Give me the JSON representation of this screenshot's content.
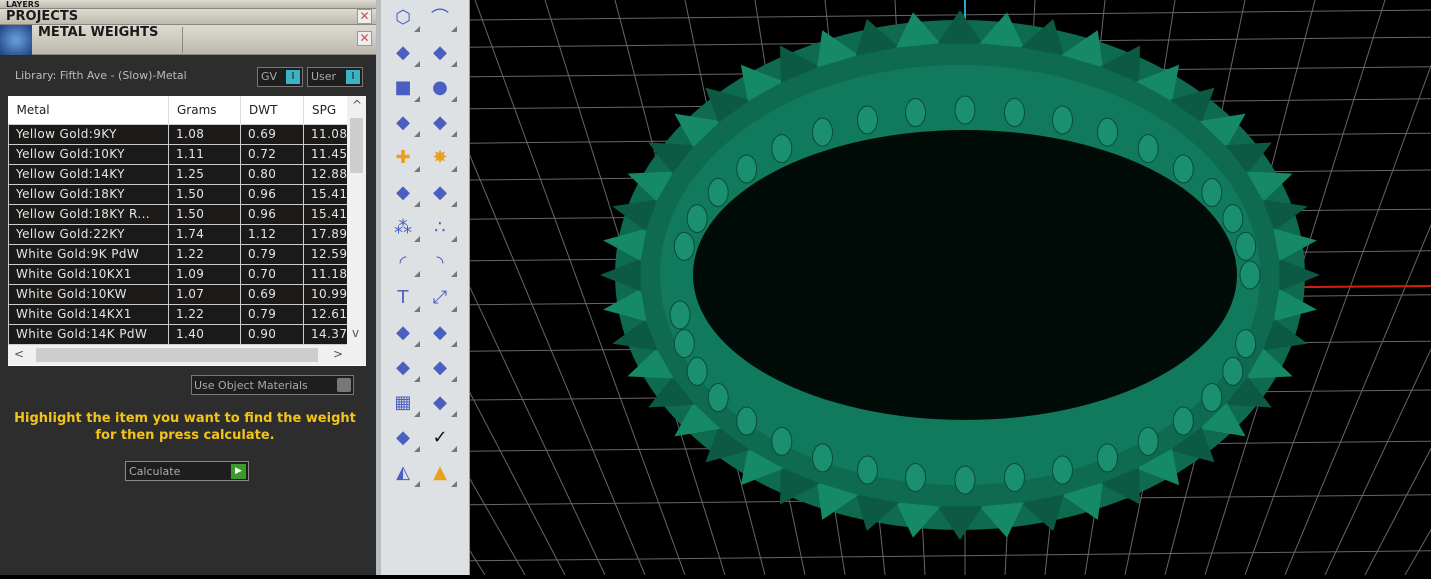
{
  "panels": {
    "layers": "LAYERS",
    "projects": "PROJECTS",
    "metal_weights": "METAL WEIGHTS"
  },
  "library": "Library: Fifth Ave - (Slow)-Metal",
  "toggles": {
    "gv": "GV",
    "user": "User"
  },
  "table": {
    "headers": [
      "Metal",
      "Grams",
      "DWT",
      "SPG"
    ],
    "rows": [
      [
        "Yellow Gold:9KY",
        "1.08",
        "0.69",
        "11.08"
      ],
      [
        "Yellow Gold:10KY",
        "1.11",
        "0.72",
        "11.45"
      ],
      [
        "Yellow Gold:14KY",
        "1.25",
        "0.80",
        "12.88"
      ],
      [
        "Yellow Gold:18KY",
        "1.50",
        "0.96",
        "15.41"
      ],
      [
        "Yellow Gold:18KY R...",
        "1.50",
        "0.96",
        "15.41"
      ],
      [
        "Yellow Gold:22KY",
        "1.74",
        "1.12",
        "17.89"
      ],
      [
        "White Gold:9K PdW",
        "1.22",
        "0.79",
        "12.59"
      ],
      [
        "White Gold:10KX1",
        "1.09",
        "0.70",
        "11.18"
      ],
      [
        "White Gold:10KW",
        "1.07",
        "0.69",
        "10.99"
      ],
      [
        "White Gold:14KX1",
        "1.22",
        "0.79",
        "12.61"
      ],
      [
        "White Gold:14K PdW",
        "1.40",
        "0.90",
        "14.37"
      ]
    ]
  },
  "use_object_materials": "Use Object Materials",
  "message": "Highlight the item you want to find the weight for then press calculate.",
  "calculate": "Calculate",
  "tools": [
    "polygon",
    "curve",
    "control-points",
    "surface",
    "box",
    "spheres",
    "cylinder",
    "deform-surface",
    "boolean",
    "explode",
    "fillet",
    "chamfer",
    "color-group",
    "spheres-array",
    "arc",
    "arc-points",
    "text",
    "scale",
    "arrange",
    "transform",
    "extrude",
    "array-up",
    "grid-array",
    "ring-rail",
    "split",
    "check",
    "primitives",
    "light"
  ],
  "colors": {
    "ring": "#127a5c",
    "message": "#f2c419",
    "x_axis": "#d02010",
    "y_axis": "#2aa8c8"
  }
}
